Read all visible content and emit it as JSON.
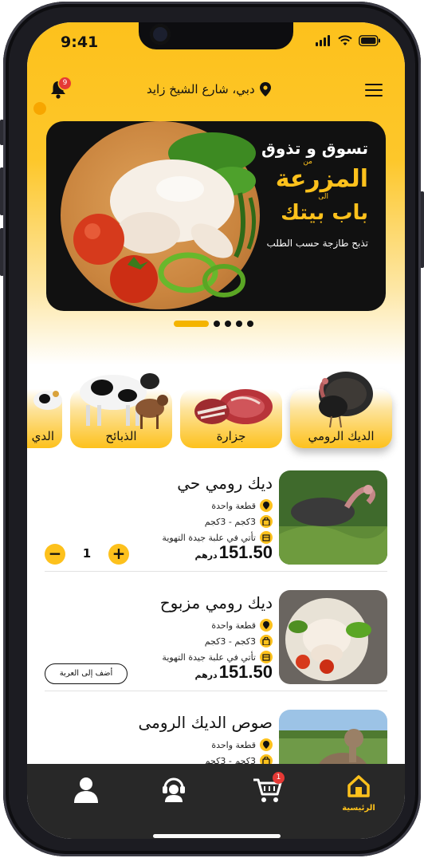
{
  "status_bar": {
    "time": "9:41"
  },
  "header": {
    "location": "دبي، شارع الشيخ زايد",
    "notification_count": "9"
  },
  "banner": {
    "line1": "تسوق و تذوق",
    "small1": "من",
    "line2": "المزرعة",
    "small2": "الى",
    "line3": "باب بيتك",
    "line4": "تذبح طازجة حسب الطلب"
  },
  "carousel": {
    "active_index": 0,
    "count": 5
  },
  "categories": [
    {
      "label": "الديك الرومي",
      "selected": true
    },
    {
      "label": "جزارة",
      "selected": false
    },
    {
      "label": "الذبائح",
      "selected": false
    },
    {
      "label": "الدي",
      "selected": false
    }
  ],
  "products": [
    {
      "name": "ديك رومي حي",
      "attr_pieces": "قطعة واحدة",
      "attr_weight": "3كجم - 3كجم",
      "attr_pack": "تأتي في علبة جيدة التهوية",
      "price": "151.50",
      "currency": "درهم",
      "quantity": "1",
      "minus": "−",
      "plus": "+"
    },
    {
      "name": "ديك رومي مزبوح",
      "attr_pieces": "قطعة واحدة",
      "attr_weight": "3كجم - 3كجم",
      "attr_pack": "تأتي في علبة جيدة التهوية",
      "price": "151.50",
      "currency": "درهم",
      "add_to_cart": "أضف إلى العربة"
    },
    {
      "name": "صوص الديك الرومى",
      "attr_pieces": "قطعة واحدة",
      "attr_weight": "3كجم - 3كجم"
    }
  ],
  "bottom_nav": {
    "home_label": "الرئيسية",
    "cart_count": "1",
    "active": "home"
  },
  "colors": {
    "accent": "#fdc11c",
    "dark": "#282828",
    "badge": "#e53935"
  },
  "icons": [
    "bell-icon",
    "location-pin-icon",
    "menu-icon",
    "pin-icon",
    "bag-icon",
    "box-icon",
    "user-icon",
    "support-icon",
    "cart-icon",
    "home-icon"
  ]
}
